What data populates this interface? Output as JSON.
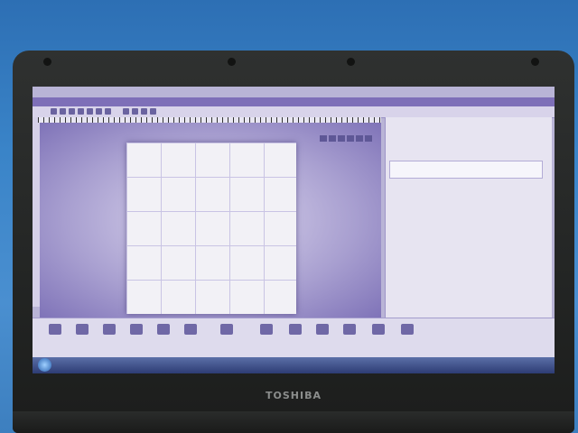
{
  "device": {
    "brand": "TOSHIBA"
  }
}
